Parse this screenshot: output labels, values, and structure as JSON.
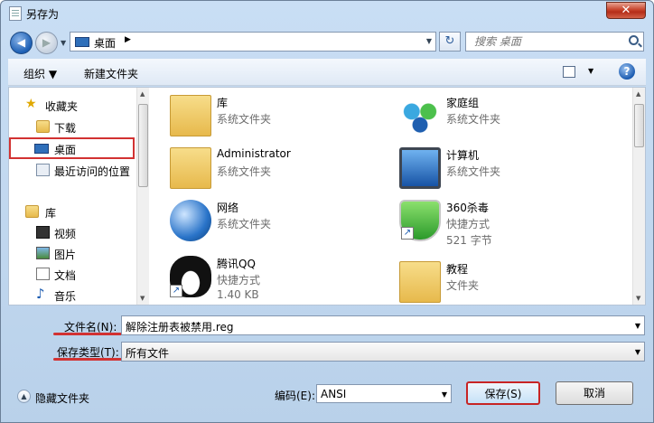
{
  "window": {
    "title": "另存为",
    "close_glyph": "✕"
  },
  "address": {
    "crumb": "桌面",
    "crumb_arrow": "▶",
    "dropdown_glyph": "▼"
  },
  "search": {
    "placeholder": "搜索 桌面"
  },
  "toolbar": {
    "organize": "组织 ▼",
    "new_folder": "新建文件夹",
    "help": "?"
  },
  "nav": {
    "items": [
      {
        "label": "收藏夹",
        "icon": "star-icon"
      },
      {
        "label": "下载",
        "icon": "download-folder-icon"
      },
      {
        "label": "桌面",
        "icon": "desktop-icon",
        "selected": true
      },
      {
        "label": "最近访问的位置",
        "icon": "recent-places-icon"
      },
      {
        "label": "库",
        "icon": "library-icon"
      },
      {
        "label": "视频",
        "icon": "videos-icon"
      },
      {
        "label": "图片",
        "icon": "pictures-icon"
      },
      {
        "label": "文档",
        "icon": "documents-icon"
      },
      {
        "label": "音乐",
        "icon": "music-icon"
      }
    ]
  },
  "files": [
    {
      "name": "库",
      "type": "系统文件夹",
      "icon": "library-folder-icon"
    },
    {
      "name": "家庭组",
      "type": "系统文件夹",
      "icon": "homegroup-icon"
    },
    {
      "name": "Administrator",
      "type": "系统文件夹",
      "icon": "user-folder-icon"
    },
    {
      "name": "计算机",
      "type": "系统文件夹",
      "icon": "computer-icon"
    },
    {
      "name": "网络",
      "type": "系统文件夹",
      "icon": "network-icon"
    },
    {
      "name": "360杀毒",
      "type": "快捷方式",
      "size": "521 字节",
      "icon": "antivirus-shield-icon"
    },
    {
      "name": "腾讯QQ",
      "type": "快捷方式",
      "size": "1.40 KB",
      "icon": "qq-penguin-icon"
    },
    {
      "name": "教程",
      "type": "文件夹",
      "icon": "folder-icon"
    }
  ],
  "form": {
    "filename_label": "文件名(N):",
    "filename_value": "解除注册表被禁用.reg",
    "filetype_label": "保存类型(T):",
    "filetype_value": "所有文件",
    "encoding_label": "编码(E):",
    "encoding_value": "ANSI"
  },
  "footer": {
    "hide_folders": "隐藏文件夹",
    "save": "保存(S)",
    "cancel": "取消"
  },
  "colors": {
    "highlight_red": "#d23232"
  }
}
